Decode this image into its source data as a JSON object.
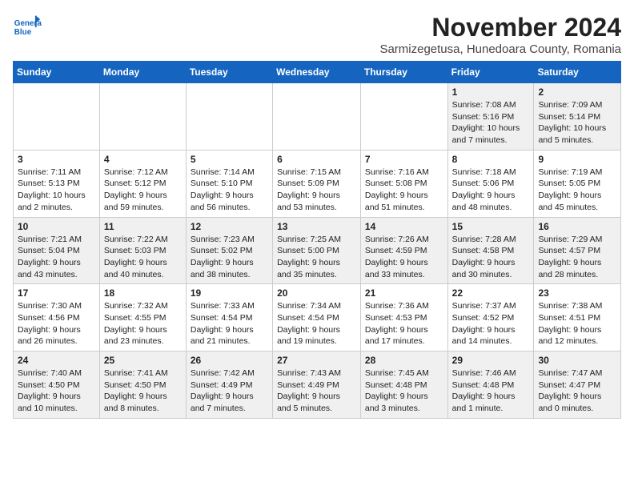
{
  "header": {
    "logo_line1": "General",
    "logo_line2": "Blue",
    "month": "November 2024",
    "location": "Sarmizegetusa, Hunedoara County, Romania"
  },
  "weekdays": [
    "Sunday",
    "Monday",
    "Tuesday",
    "Wednesday",
    "Thursday",
    "Friday",
    "Saturday"
  ],
  "weeks": [
    [
      {
        "day": "",
        "content": ""
      },
      {
        "day": "",
        "content": ""
      },
      {
        "day": "",
        "content": ""
      },
      {
        "day": "",
        "content": ""
      },
      {
        "day": "",
        "content": ""
      },
      {
        "day": "1",
        "content": "Sunrise: 7:08 AM\nSunset: 5:16 PM\nDaylight: 10 hours and 7 minutes."
      },
      {
        "day": "2",
        "content": "Sunrise: 7:09 AM\nSunset: 5:14 PM\nDaylight: 10 hours and 5 minutes."
      }
    ],
    [
      {
        "day": "3",
        "content": "Sunrise: 7:11 AM\nSunset: 5:13 PM\nDaylight: 10 hours and 2 minutes."
      },
      {
        "day": "4",
        "content": "Sunrise: 7:12 AM\nSunset: 5:12 PM\nDaylight: 9 hours and 59 minutes."
      },
      {
        "day": "5",
        "content": "Sunrise: 7:14 AM\nSunset: 5:10 PM\nDaylight: 9 hours and 56 minutes."
      },
      {
        "day": "6",
        "content": "Sunrise: 7:15 AM\nSunset: 5:09 PM\nDaylight: 9 hours and 53 minutes."
      },
      {
        "day": "7",
        "content": "Sunrise: 7:16 AM\nSunset: 5:08 PM\nDaylight: 9 hours and 51 minutes."
      },
      {
        "day": "8",
        "content": "Sunrise: 7:18 AM\nSunset: 5:06 PM\nDaylight: 9 hours and 48 minutes."
      },
      {
        "day": "9",
        "content": "Sunrise: 7:19 AM\nSunset: 5:05 PM\nDaylight: 9 hours and 45 minutes."
      }
    ],
    [
      {
        "day": "10",
        "content": "Sunrise: 7:21 AM\nSunset: 5:04 PM\nDaylight: 9 hours and 43 minutes."
      },
      {
        "day": "11",
        "content": "Sunrise: 7:22 AM\nSunset: 5:03 PM\nDaylight: 9 hours and 40 minutes."
      },
      {
        "day": "12",
        "content": "Sunrise: 7:23 AM\nSunset: 5:02 PM\nDaylight: 9 hours and 38 minutes."
      },
      {
        "day": "13",
        "content": "Sunrise: 7:25 AM\nSunset: 5:00 PM\nDaylight: 9 hours and 35 minutes."
      },
      {
        "day": "14",
        "content": "Sunrise: 7:26 AM\nSunset: 4:59 PM\nDaylight: 9 hours and 33 minutes."
      },
      {
        "day": "15",
        "content": "Sunrise: 7:28 AM\nSunset: 4:58 PM\nDaylight: 9 hours and 30 minutes."
      },
      {
        "day": "16",
        "content": "Sunrise: 7:29 AM\nSunset: 4:57 PM\nDaylight: 9 hours and 28 minutes."
      }
    ],
    [
      {
        "day": "17",
        "content": "Sunrise: 7:30 AM\nSunset: 4:56 PM\nDaylight: 9 hours and 26 minutes."
      },
      {
        "day": "18",
        "content": "Sunrise: 7:32 AM\nSunset: 4:55 PM\nDaylight: 9 hours and 23 minutes."
      },
      {
        "day": "19",
        "content": "Sunrise: 7:33 AM\nSunset: 4:54 PM\nDaylight: 9 hours and 21 minutes."
      },
      {
        "day": "20",
        "content": "Sunrise: 7:34 AM\nSunset: 4:54 PM\nDaylight: 9 hours and 19 minutes."
      },
      {
        "day": "21",
        "content": "Sunrise: 7:36 AM\nSunset: 4:53 PM\nDaylight: 9 hours and 17 minutes."
      },
      {
        "day": "22",
        "content": "Sunrise: 7:37 AM\nSunset: 4:52 PM\nDaylight: 9 hours and 14 minutes."
      },
      {
        "day": "23",
        "content": "Sunrise: 7:38 AM\nSunset: 4:51 PM\nDaylight: 9 hours and 12 minutes."
      }
    ],
    [
      {
        "day": "24",
        "content": "Sunrise: 7:40 AM\nSunset: 4:50 PM\nDaylight: 9 hours and 10 minutes."
      },
      {
        "day": "25",
        "content": "Sunrise: 7:41 AM\nSunset: 4:50 PM\nDaylight: 9 hours and 8 minutes."
      },
      {
        "day": "26",
        "content": "Sunrise: 7:42 AM\nSunset: 4:49 PM\nDaylight: 9 hours and 7 minutes."
      },
      {
        "day": "27",
        "content": "Sunrise: 7:43 AM\nSunset: 4:49 PM\nDaylight: 9 hours and 5 minutes."
      },
      {
        "day": "28",
        "content": "Sunrise: 7:45 AM\nSunset: 4:48 PM\nDaylight: 9 hours and 3 minutes."
      },
      {
        "day": "29",
        "content": "Sunrise: 7:46 AM\nSunset: 4:48 PM\nDaylight: 9 hours and 1 minute."
      },
      {
        "day": "30",
        "content": "Sunrise: 7:47 AM\nSunset: 4:47 PM\nDaylight: 9 hours and 0 minutes."
      }
    ]
  ]
}
